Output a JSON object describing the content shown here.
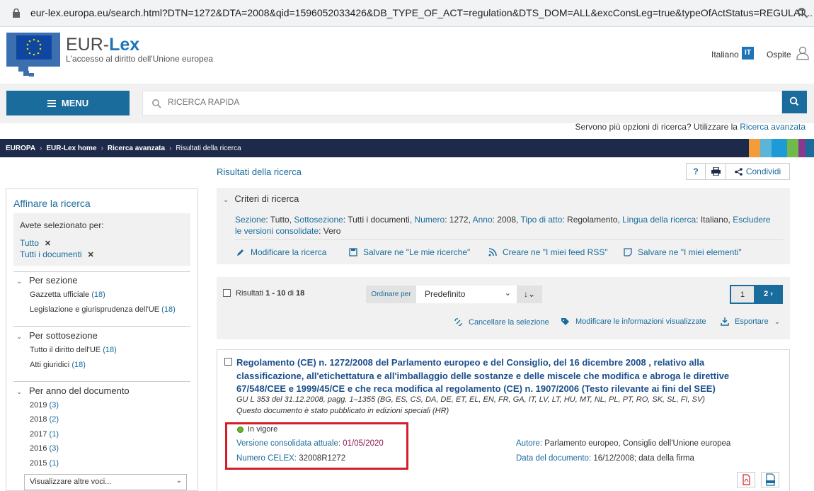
{
  "browser": {
    "url": "eur-lex.europa.eu/search.html?DTN=1272&DTA=2008&qid=1596052033426&DB_TYPE_OF_ACT=regulation&DTS_DOM=ALL&excConsLeg=true&typeOfActStatus=REGULAT..."
  },
  "header": {
    "brand_a": "EUR-",
    "brand_b": "Lex",
    "tagline": "L'accesso al diritto dell'Unione europea",
    "language": "Italiano",
    "language_code": "IT",
    "user": "Ospite"
  },
  "toolbar": {
    "menu_label": "MENU",
    "search_placeholder": "RICERCA RAPIDA",
    "advanced_prompt": "Servono più opzioni di ricerca? Utilizzare la",
    "advanced_link": "Ricerca avanzata"
  },
  "breadcrumb": [
    "EUROPA",
    "EUR-Lex home",
    "Ricerca avanzata",
    "Risultati della ricerca"
  ],
  "facets": {
    "title": "Affinare la ricerca",
    "selected_label": "Avete selezionato per:",
    "selected": [
      "Tutto",
      "Tutti i documenti"
    ],
    "groups": [
      {
        "title": "Per sezione",
        "items": [
          {
            "label": "Gazzetta ufficiale",
            "count": "(18)"
          },
          {
            "label": "Legislazione e giurisprudenza dell'UE",
            "count": "(18)"
          }
        ]
      },
      {
        "title": "Per sottosezione",
        "items": [
          {
            "label": "Tutto il diritto dell'UE",
            "count": "(18)"
          },
          {
            "label": "Atti giuridici",
            "count": "(18)"
          }
        ]
      },
      {
        "title": "Per anno del documento",
        "items": [
          {
            "label": "2019",
            "count": "(3)"
          },
          {
            "label": "2018",
            "count": "(2)"
          },
          {
            "label": "2017",
            "count": "(1)"
          },
          {
            "label": "2016",
            "count": "(3)"
          },
          {
            "label": "2015",
            "count": "(1)"
          }
        ]
      }
    ],
    "more_label": "Visualizzare altre voci..."
  },
  "results": {
    "heading": "Risultati della ricerca",
    "share_label": "Condividi",
    "criteria": {
      "title": "Criteri di ricerca",
      "pairs": [
        {
          "k": "Sezione",
          "v": "Tutto"
        },
        {
          "k": "Sottosezione",
          "v": "Tutti i documenti"
        },
        {
          "k": "Numero",
          "v": "1272"
        },
        {
          "k": "Anno",
          "v": "2008"
        },
        {
          "k": "Tipo di atto",
          "v": "Regolamento"
        },
        {
          "k": "Lingua della ricerca",
          "v": "Italiano"
        },
        {
          "k": "Escludere le versioni consolidate",
          "v": "Vero"
        }
      ],
      "actions": [
        "Modificare la ricerca",
        "Salvare ne \"Le mie ricerche\"",
        "Creare ne \"I miei feed RSS\"",
        "Salvare ne \"I miei elementi\""
      ]
    },
    "list": {
      "count_prefix": "Risultati",
      "count_range": "1 - 10",
      "count_of": "di",
      "count_total": "18",
      "sort_label": "Ordinare per",
      "sort_value": "Predefinito",
      "page_current": "1",
      "page_next": "2",
      "actions": [
        "Cancellare la selezione",
        "Modificare le informazioni visualizzate",
        "Esportare"
      ]
    },
    "item": {
      "title": "Regolamento (CE) n. 1272/2008 del Parlamento europeo e del Consiglio, del 16 dicembre 2008 , relativo alla classificazione, all'etichettatura e all'imballaggio delle sostanze e delle miscele che modifica e abroga le direttive 67/548/CEE e 1999/45/CE e che reca modifica al regolamento (CE) n. 1907/2006 (Testo rilevante ai fini del SEE)",
      "oj_ref": "GU L 353 del 31.12.2008, pagg. 1–1355 (BG, ES, CS, DA, DE, ET, EL, EN, FR, GA, IT, LV, LT, HU, MT, NL, PL, PT, RO, SK, SL, FI, SV)",
      "special": "Questo documento è stato pubblicato in edizioni speciali (HR)",
      "status": "In vigore",
      "cv_label": "Versione consolidata attuale:",
      "cv_value": "01/05/2020",
      "celex_label": "Numero CELEX:",
      "celex_value": "32008R1272",
      "author_label": "Autore:",
      "author_value": "Parlamento europeo, Consiglio dell'Unione europea",
      "date_label": "Data del documento:",
      "date_value": "16/12/2008; data della firma"
    }
  },
  "colors": {
    "accent": "#1a6c9c",
    "highlight": "#d51d2a",
    "status_green": "#66b32e",
    "crumb_bg": "#1e2a4a"
  }
}
